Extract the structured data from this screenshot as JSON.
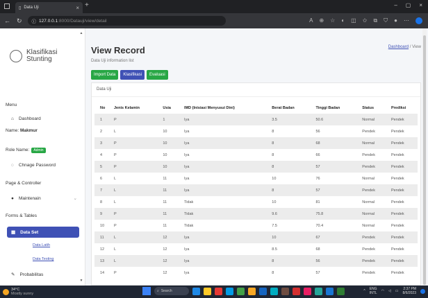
{
  "browser": {
    "tab_title": "Data Uji",
    "url_host": "127.0.0.1",
    "url_rest": ":8000/Datauji/view/detail",
    "new_tab": "+",
    "close": "×",
    "win_min": "–",
    "win_close": "×"
  },
  "sidebar": {
    "brand_line1": "Klasifikasi",
    "brand_line2": "Stunting",
    "menu_label": "Menu",
    "dashboard": "Dashboard",
    "name_label": "Name:",
    "name_value": "Makmur",
    "role_label": "Role Name:",
    "role_value": "Admin",
    "change_password": "Chnage Password",
    "page_controller": "Page & Controller",
    "maintenain": "Maintenain",
    "forms_tables": "Forms & Tables",
    "data_set": "Data Set",
    "data_latih": "Data Latih",
    "data_testing": "Data Testing",
    "probabilitas": "Probabilitas"
  },
  "header": {
    "title": "View Record",
    "subtitle": "Data Uji information list",
    "breadcrumb_link": "Dashboard",
    "breadcrumb_current": " / View"
  },
  "buttons": {
    "import": "Import Data",
    "klasifikasi": "Klasifikasi",
    "evaluasi": "Evaluasi"
  },
  "card_title": "Data Uji",
  "table": {
    "headers": [
      "No",
      "Jenis Kelamin",
      "Usia",
      "IMD (Inisiasi Menyusui Dini)",
      "Berat Badan",
      "Tinggi Badan",
      "Status",
      "Prediksi"
    ],
    "rows": [
      [
        "1",
        "P",
        "1",
        "Iya",
        "3.5",
        "50.6",
        "Normal",
        "Pendek"
      ],
      [
        "2",
        "L",
        "10",
        "Iya",
        "8",
        "56",
        "Pendek",
        "Pendek"
      ],
      [
        "3",
        "P",
        "10",
        "Iya",
        "8",
        "68",
        "Normal",
        "Pendek"
      ],
      [
        "4",
        "P",
        "10",
        "Iya",
        "8",
        "66",
        "Pendek",
        "Pendek"
      ],
      [
        "5",
        "P",
        "10",
        "Iya",
        "8",
        "57",
        "Pendek",
        "Pendek"
      ],
      [
        "6",
        "L",
        "11",
        "Iya",
        "10",
        "76",
        "Normal",
        "Pendek"
      ],
      [
        "7",
        "L",
        "11",
        "Iya",
        "8",
        "57",
        "Pendek",
        "Pendek"
      ],
      [
        "8",
        "L",
        "11",
        "Tidak",
        "10",
        "81",
        "Normal",
        "Pendek"
      ],
      [
        "9",
        "P",
        "11",
        "Tidak",
        "9.6",
        "75.8",
        "Normal",
        "Pendek"
      ],
      [
        "10",
        "P",
        "11",
        "Tidak",
        "7.5",
        "70.4",
        "Normal",
        "Pendek"
      ],
      [
        "11",
        "L",
        "12",
        "Iya",
        "10",
        "67",
        "Pendek",
        "Pendek"
      ],
      [
        "12",
        "L",
        "12",
        "Iya",
        "8.5",
        "68",
        "Pendek",
        "Pendek"
      ],
      [
        "13",
        "L",
        "12",
        "Iya",
        "8",
        "56",
        "Pendek",
        "Pendek"
      ],
      [
        "14",
        "P",
        "12",
        "Iya",
        "8",
        "57",
        "Pendek",
        "Pendek"
      ]
    ]
  },
  "taskbar": {
    "temp": "34°C",
    "weather": "Mostly sunny",
    "search": "Search",
    "lang": "ENG",
    "region": "INTL",
    "time": "2:37 PM",
    "date": "8/6/2023"
  },
  "colors": {
    "accent": "#3f51b5",
    "green": "#28a745"
  }
}
